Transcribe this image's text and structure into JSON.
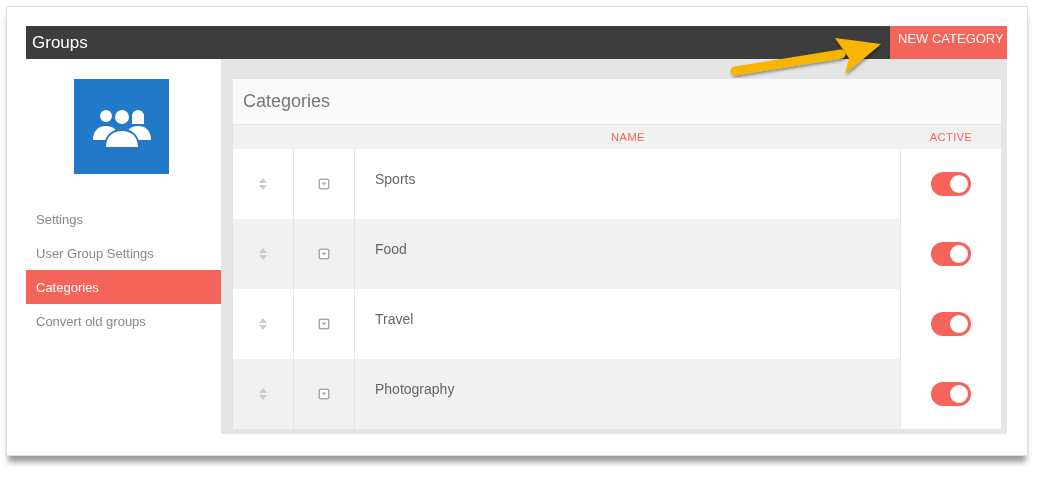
{
  "header": {
    "title": "Groups",
    "action": "NEW CATEGORY"
  },
  "sidebar": {
    "items": [
      {
        "label": "Settings",
        "selected": false
      },
      {
        "label": "User Group Settings",
        "selected": false
      },
      {
        "label": "Categories",
        "selected": true
      },
      {
        "label": "Convert old groups",
        "selected": false
      }
    ]
  },
  "panel": {
    "title": "Categories",
    "columns": [
      "NAME",
      "ACTIVE"
    ],
    "rows": [
      {
        "name": "Sports",
        "active": true
      },
      {
        "name": "Food",
        "active": true
      },
      {
        "name": "Travel",
        "active": true
      },
      {
        "name": "Photography",
        "active": true
      }
    ]
  }
}
